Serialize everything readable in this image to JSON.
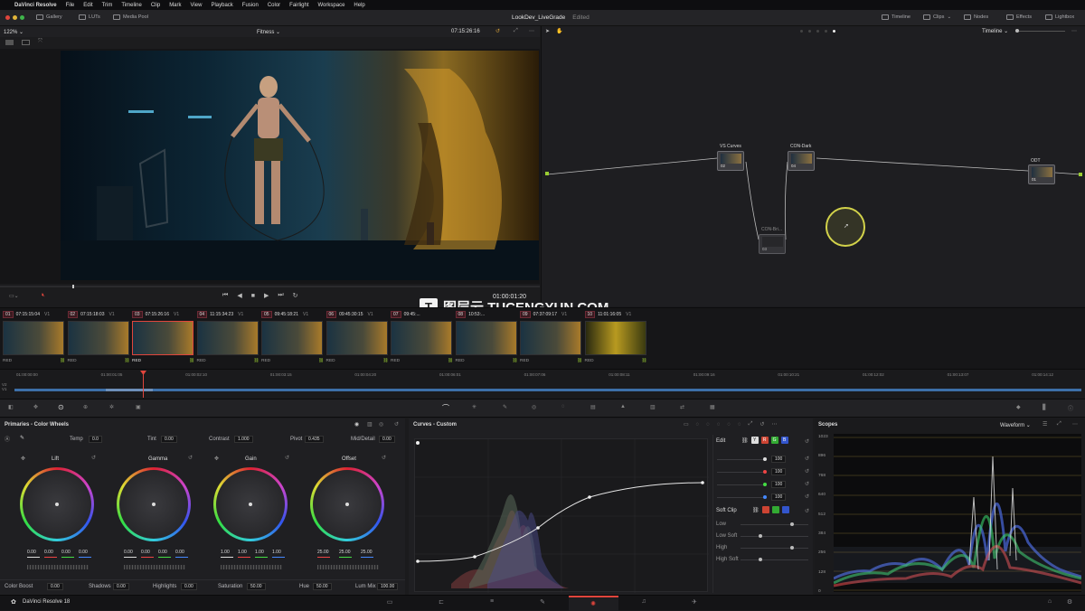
{
  "menubar": {
    "app_name": "DaVinci Resolve",
    "items": [
      "File",
      "Edit",
      "Trim",
      "Timeline",
      "Clip",
      "Mark",
      "View",
      "Playback",
      "Fusion",
      "Color",
      "Fairlight",
      "Workspace",
      "Help"
    ]
  },
  "toolbar": {
    "gallery": "Gallery",
    "luts": "LUTs",
    "media_pool": "Media Pool",
    "project_title": "LookDev_LiveGrade",
    "project_status": "Edited",
    "timeline": "Timeline",
    "clips": "Clips",
    "nodes": "Nodes",
    "effects": "Effects",
    "lightbox": "Lightbox"
  },
  "viewer": {
    "zoom": "122%",
    "clip_name": "Fitness",
    "timecode": "07:15:26:16",
    "playhead_timecode": "01:00:01:20"
  },
  "node_editor": {
    "mode": "Timeline",
    "nodes": [
      {
        "title": "VS Curves",
        "label": "02"
      },
      {
        "title": "CON-Dark",
        "label": "04"
      },
      {
        "title": "CON-Bri...",
        "label": "03"
      },
      {
        "title": "ODT",
        "label": "01"
      }
    ]
  },
  "watermark": "图层云 TUCENGYUN.COM",
  "clips": [
    {
      "num": "01",
      "tc": "07:15:15:04",
      "track": "V1",
      "tag": "RED"
    },
    {
      "num": "02",
      "tc": "07:15:18:03",
      "track": "V1",
      "tag": "RED"
    },
    {
      "num": "03",
      "tc": "07:15:26:16",
      "track": "V1",
      "tag": "RED"
    },
    {
      "num": "04",
      "tc": "11:15:34:23",
      "track": "V1",
      "tag": "RED"
    },
    {
      "num": "05",
      "tc": "09:45:18:21",
      "track": "V1",
      "tag": "RED"
    },
    {
      "num": "06",
      "tc": "09:45:30:15",
      "track": "V1",
      "tag": "RED"
    },
    {
      "num": "07",
      "tc": "09:45:...",
      "track": "",
      "tag": "RED"
    },
    {
      "num": "08",
      "tc": "10:53:...",
      "track": "",
      "tag": "RED"
    },
    {
      "num": "09",
      "tc": "07:37:09:17",
      "track": "V1",
      "tag": "RED"
    },
    {
      "num": "10",
      "tc": "11:01:16:05",
      "track": "V1",
      "tag": "RED"
    }
  ],
  "ruler_ticks": [
    "01:00:00:00",
    "01:00:01:05",
    "01:00:02:10",
    "01:00:03:15",
    "01:00:04:20",
    "01:00:06:01",
    "01:00:07:06",
    "01:00:08:11",
    "01:00:09:16",
    "01:00:10:21",
    "01:00:12:02",
    "01:00:13:07",
    "01:00:14:12"
  ],
  "tracks": [
    "V2",
    "V1"
  ],
  "primaries": {
    "title": "Primaries - Color Wheels",
    "temp_label": "Temp",
    "temp": "0.0",
    "tint_label": "Tint",
    "tint": "0.00",
    "contrast_label": "Contrast",
    "contrast": "1.000",
    "pivot_label": "Pivot",
    "pivot": "0.435",
    "middetail_label": "Mid/Detail",
    "middetail": "0.00",
    "wheels": [
      {
        "name": "Lift",
        "values": [
          "0.00",
          "0.00",
          "0.00",
          "0.00"
        ]
      },
      {
        "name": "Gamma",
        "values": [
          "0.00",
          "0.00",
          "0.00",
          "0.00"
        ]
      },
      {
        "name": "Gain",
        "values": [
          "1.00",
          "1.00",
          "1.00",
          "1.00"
        ]
      },
      {
        "name": "Offset",
        "values": [
          "25.00",
          "25.00",
          "25.00"
        ]
      }
    ],
    "colorboost_label": "Color Boost",
    "colorboost": "0.00",
    "shadows_label": "Shadows",
    "shadows": "0.00",
    "highlights_label": "Highlights",
    "highlights": "0.00",
    "saturation_label": "Saturation",
    "saturation": "50.00",
    "hue_label": "Hue",
    "hue": "50.00",
    "lummix_label": "Lum Mix",
    "lummix": "100.00"
  },
  "curves": {
    "title": "Curves - Custom",
    "edit_label": "Edit",
    "channel_values": [
      "100",
      "100",
      "100",
      "100"
    ],
    "softclip_label": "Soft Clip",
    "softclip_rows": [
      "Low",
      "Low Soft",
      "High",
      "High Soft"
    ]
  },
  "scopes": {
    "title": "Scopes",
    "mode": "Waveform",
    "scale": [
      "1023",
      "896",
      "768",
      "640",
      "512",
      "384",
      "256",
      "128",
      "0"
    ]
  },
  "statusbar": {
    "app_version": "DaVinci Resolve 18"
  },
  "colors": {
    "accent": "#e0453c",
    "node_active": "#d2d24a",
    "timeline_bar": "#3d6fa8"
  }
}
